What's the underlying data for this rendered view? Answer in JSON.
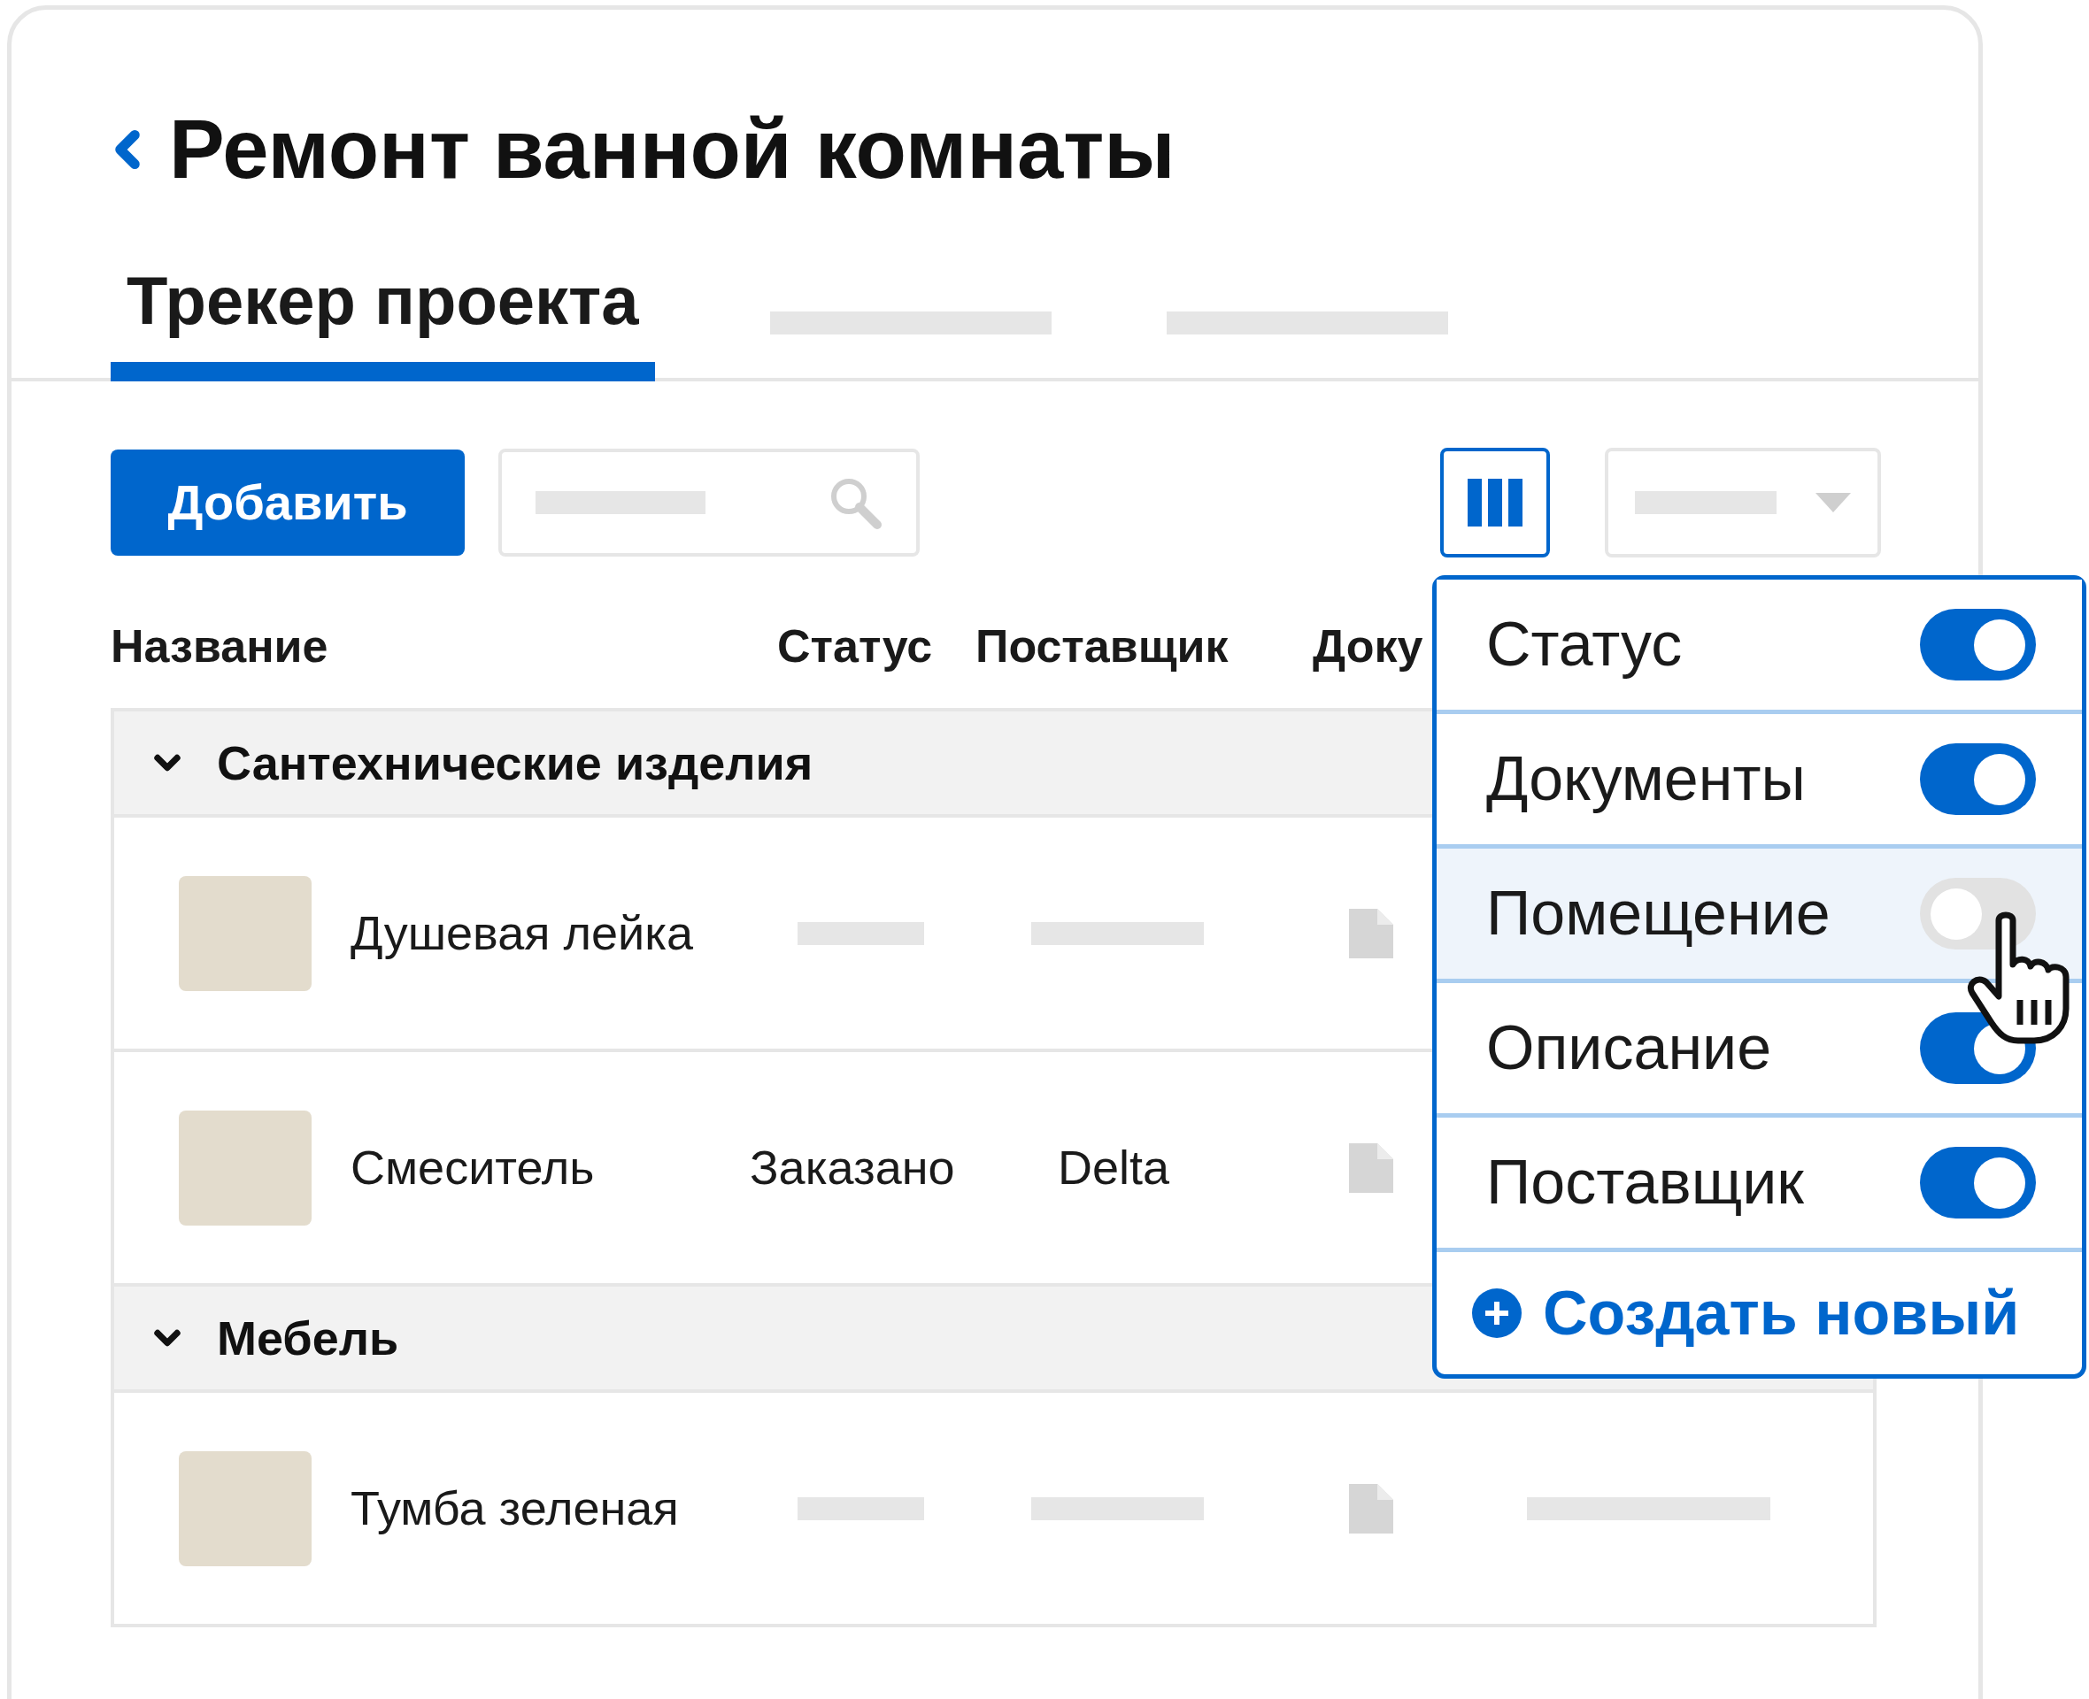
{
  "title": "Ремонт ванной комнаты",
  "tabs": [
    {
      "kind": "text",
      "label": "Трекер проекта",
      "selected": true
    },
    {
      "kind": "placeholder",
      "selected": false
    },
    {
      "kind": "placeholder",
      "selected": false
    }
  ],
  "add_button": "Добавить",
  "columns": [
    "Название",
    "Статус",
    "Поставщик",
    "Доку"
  ],
  "groups": [
    {
      "name": "Сантехнические изделия",
      "expanded": true,
      "items": [
        {
          "name": "Душевая лейка",
          "trailing_placeholder": false
        },
        {
          "name": "Смеситель",
          "status": "Заказано",
          "supplier": "Delta",
          "trailing_placeholder": false
        }
      ]
    },
    {
      "name": "Мебель",
      "expanded": true,
      "items": [
        {
          "name": "Тумба зеленая",
          "trailing_placeholder": true
        }
      ]
    }
  ],
  "column_menu": {
    "items": [
      {
        "label": "Статус",
        "on": true,
        "highlighted": false
      },
      {
        "label": "Документы",
        "on": true,
        "highlighted": false
      },
      {
        "label": "Помещение",
        "on": false,
        "highlighted": true
      },
      {
        "label": "Описание",
        "on": true,
        "highlighted": false
      },
      {
        "label": "Поставщик",
        "on": true,
        "highlighted": false
      }
    ],
    "create_label": "Создать новый"
  }
}
